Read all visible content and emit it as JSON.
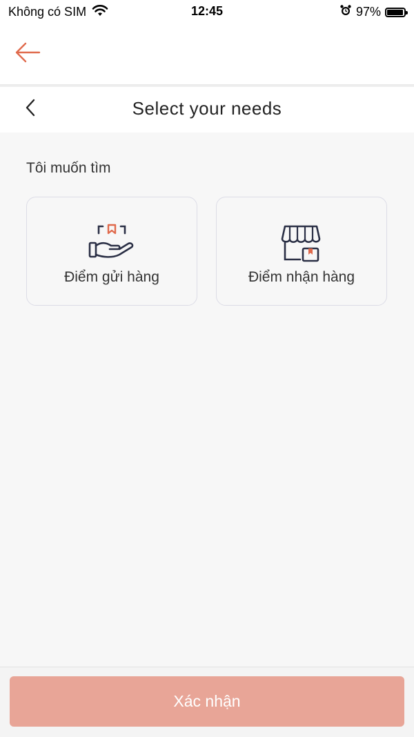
{
  "status_bar": {
    "carrier": "Không có SIM",
    "time": "12:45",
    "battery_percent": "97%",
    "battery_level": 0.97
  },
  "nav": {
    "back_icon": "arrow-left-icon",
    "accent_color": "#e06a4c"
  },
  "header": {
    "title": "Select your needs",
    "back_icon": "chevron-left-icon"
  },
  "section": {
    "label": "Tôi muốn tìm"
  },
  "options": [
    {
      "label": "Điểm gửi hàng",
      "icon": "hand-package-icon"
    },
    {
      "label": "Điểm nhận hàng",
      "icon": "store-package-icon"
    }
  ],
  "footer": {
    "confirm_label": "Xác nhận",
    "confirm_color": "#e8a597"
  }
}
